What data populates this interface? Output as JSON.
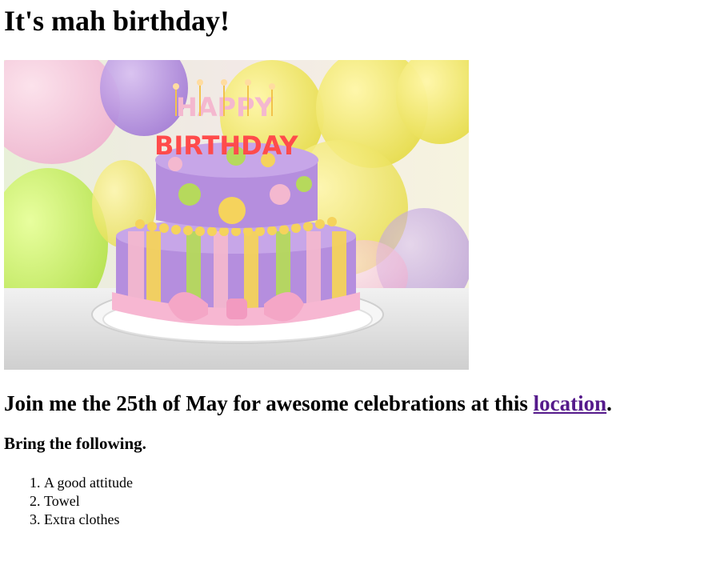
{
  "page": {
    "title": "It's mah birthday!",
    "image": {
      "alt": "Birthday cake",
      "candles_row1": "HAPPY",
      "candles_row2": "BIRTHDAY",
      "colors": {
        "purple": "#b58ede",
        "yellow": "#f5d35c",
        "green": "#b6d95c",
        "pink": "#f4b8cf"
      }
    },
    "invite": {
      "prefix": "Join me the 25th of May for awesome celebrations at this ",
      "link_text": "location",
      "suffix": "."
    },
    "bring": {
      "heading": "Bring the following.",
      "items": [
        "A good attitude",
        "Towel",
        "Extra clothes"
      ]
    }
  }
}
